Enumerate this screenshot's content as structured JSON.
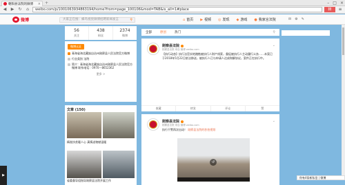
{
  "browser": {
    "tab_title": "朝阳县法院的微博",
    "url": "weibo.com/p/1001063934863194/home?from=page_100106&mod=TAB&is_all=1#place",
    "go_label": "转"
  },
  "weibo_nav": {
    "logo_text": "微博",
    "search_placeholder": "大家正在搜：蜂鸟视觉微博招聘新闻发言",
    "links": [
      "首页",
      "视频",
      "发现",
      "游戏",
      "我家言法院"
    ],
    "tools": [
      "✉",
      "⚙",
      "✎"
    ]
  },
  "profile": {
    "stats": [
      {
        "num": "56",
        "label": "关注"
      },
      {
        "num": "438",
        "label": "粉丝"
      },
      {
        "num": "2374",
        "label": "微博"
      }
    ],
    "v_badge": "微博认证",
    "rows": [
      {
        "text": "青海省海北藏族自治州刚察县人民法院官方微博"
      },
      {
        "text": "行业类别 法院"
      },
      {
        "text": "简介：青海省海北藏族自治州刚察县人民法院官方微博 联系电话：0970—8652362"
      }
    ],
    "more": "更多 >",
    "photos_title": "文章 (150)",
    "caption1": "精准扶贫暖人心 真情送物献温暖",
    "caption2": "省委督导组指导刚察县法院开展工作"
  },
  "feed": {
    "tabs": [
      "全部",
      "原创",
      "热门"
    ],
    "posts": [
      {
        "name": "刚察县法院",
        "meta": "刚察县法院 来自 微博 weibo.com",
        "text": "【执行动态】执行法官实地踏勘被执行人财产线索，督促被执行人主动履行义务……本案已于2018年5月22日依法移送，被执行人已与申请人达成和解协议，案件正在执行中。",
        "actions": [
          "收藏",
          "转发",
          "评论",
          "赞"
        ]
      },
      {
        "name": "刚察县法院",
        "meta": "刚察县法院 来自 微博 weibo.com",
        "text": "执行干警再次出动！",
        "link": "刚察县法院的秒拍视频",
        "actions": [
          "收藏",
          "转发",
          "评论",
          "赞"
        ]
      }
    ]
  },
  "right": {
    "msg": "你有4条新私信 | 微博"
  }
}
